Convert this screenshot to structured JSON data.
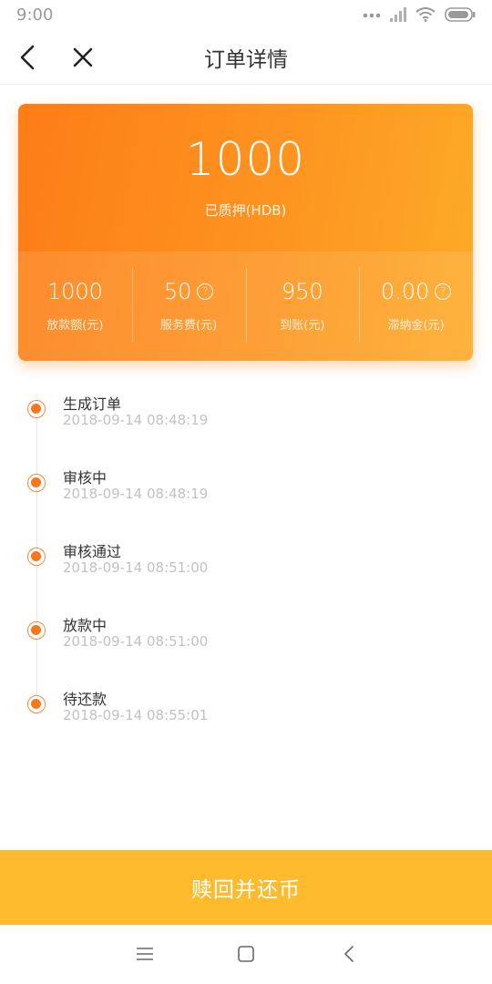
{
  "status_bar": {
    "time": "9:00",
    "icons": [
      "more-dots-icon",
      "signal-icon",
      "wifi-icon",
      "battery-icon"
    ]
  },
  "nav": {
    "title": "订单详情",
    "back_icon": "back-arrow-icon",
    "close_icon": "close-icon"
  },
  "summary": {
    "amount": "1000",
    "amount_label": "已质押(HDB)",
    "stats": [
      {
        "value": "1000",
        "label": "放款额(元)",
        "help": false
      },
      {
        "value": "50",
        "label": "服务费(元)",
        "help": true
      },
      {
        "value": "950",
        "label": "到账(元)",
        "help": false
      },
      {
        "value": "0.00",
        "label": "滞纳金(元)",
        "help": true
      }
    ]
  },
  "timeline": [
    {
      "title": "生成订单",
      "time": "2018-09-14 08:48:19"
    },
    {
      "title": "审核中",
      "time": "2018-09-14 08:48:19"
    },
    {
      "title": "审核通过",
      "time": "2018-09-14 08:51:00"
    },
    {
      "title": "放款中",
      "time": "2018-09-14 08:51:00"
    },
    {
      "title": "待还款",
      "time": "2018-09-14 08:55:01"
    }
  ],
  "action": {
    "label": "赎回并还币"
  },
  "colors": {
    "accent": "#fd8a1e",
    "action": "#fdbb2d",
    "dot": "#f7771c"
  }
}
